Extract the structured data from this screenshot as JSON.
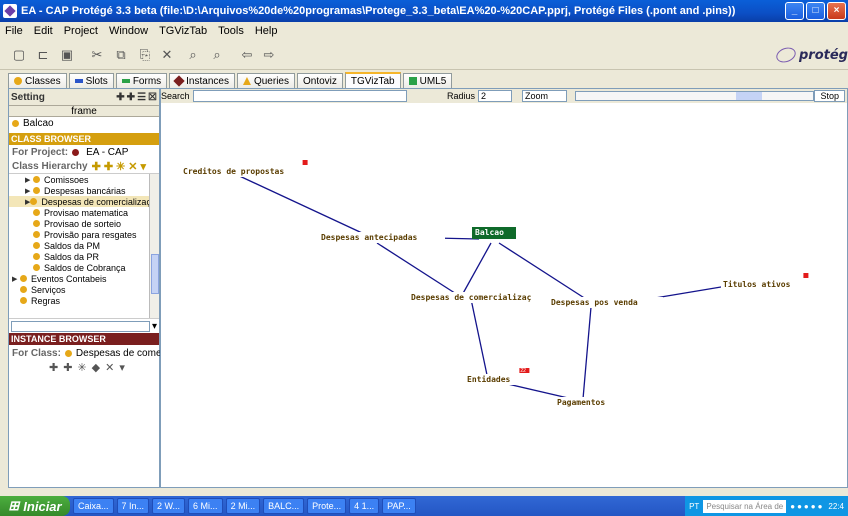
{
  "window": {
    "title": "EA - CAP  Protégé 3.3 beta    (file:\\D:\\Arquivos%20de%20programas\\Protege_3.3_beta\\EA%20-%20CAP.pprj, Protégé Files (.pont and .pins))"
  },
  "menu": [
    "File",
    "Edit",
    "Project",
    "Window",
    "TGVizTab",
    "Tools",
    "Help"
  ],
  "brand": "protég",
  "tabs": [
    {
      "label": "Classes",
      "color": "#e6a819"
    },
    {
      "label": "Slots",
      "color": "#2b55c9"
    },
    {
      "label": "Forms",
      "color": "#2aa148"
    },
    {
      "label": "Instances",
      "color": "#7a1f1f"
    },
    {
      "label": "Queries",
      "color": "#e6a819"
    },
    {
      "label": "Ontoviz",
      "color": ""
    },
    {
      "label": "TGVizTab",
      "color": ""
    },
    {
      "label": "UML5",
      "color": "#2aa148"
    }
  ],
  "left": {
    "setting_label": "Setting",
    "frame_header": "frame",
    "frame_value": "Balcao",
    "class_browser_title": "CLASS BROWSER",
    "for_project_label": "For Project:",
    "for_project_value": "EA - CAP",
    "class_hierarchy_label": "Class Hierarchy",
    "tree": [
      {
        "label": "Comissoes",
        "arrow": true,
        "indent": 1,
        "selected": false
      },
      {
        "label": "Despesas bancárias",
        "arrow": true,
        "indent": 1,
        "selected": false
      },
      {
        "label": "Despesas de comercialização",
        "arrow": true,
        "indent": 1,
        "selected": true
      },
      {
        "label": "Provisao matematica",
        "arrow": false,
        "indent": 1,
        "selected": false
      },
      {
        "label": "Provisao de sorteio",
        "arrow": false,
        "indent": 1,
        "selected": false
      },
      {
        "label": "Provisão para resgates",
        "arrow": false,
        "indent": 1,
        "selected": false
      },
      {
        "label": "Saldos da PM",
        "arrow": false,
        "indent": 1,
        "selected": false
      },
      {
        "label": "Saldos da PR",
        "arrow": false,
        "indent": 1,
        "selected": false
      },
      {
        "label": "Saldos de Cobrança",
        "arrow": false,
        "indent": 1,
        "selected": false
      },
      {
        "label": "Eventos Contabeis",
        "arrow": true,
        "indent": 0,
        "selected": false
      },
      {
        "label": "Serviços",
        "arrow": false,
        "indent": 0,
        "selected": false
      },
      {
        "label": "Regras",
        "arrow": false,
        "indent": 0,
        "selected": false
      }
    ],
    "instance_browser_title": "INSTANCE BROWSER",
    "for_class_label": "For Class:",
    "for_class_value": "Despesas de comercialização"
  },
  "graph_toolbar": {
    "search_label": "Search",
    "radius_label": "Radius",
    "radius_value": "2",
    "zoom_label": "Zoom",
    "stop_label": "Stop"
  },
  "graph": {
    "nodes": [
      {
        "id": "creditos",
        "label": "Creditos de propostas",
        "badge": ""
      },
      {
        "id": "antecipadas",
        "label": "Despesas antecipadas",
        "badge": ""
      },
      {
        "id": "balcao",
        "label": "Balcao",
        "badge": ""
      },
      {
        "id": "comercializ",
        "label": "Despesas de comercializaç",
        "badge": ""
      },
      {
        "id": "posvenda",
        "label": "Despesas pos venda",
        "badge": ""
      },
      {
        "id": "titulos",
        "label": "Titulos ativos",
        "badge": ""
      },
      {
        "id": "entidades",
        "label": "Entidades",
        "badge": "22"
      },
      {
        "id": "pagamentos",
        "label": "Pagamentos",
        "badge": ""
      }
    ]
  },
  "taskbar": {
    "start_label": "Iniciar",
    "items": [
      "Caixa...",
      "7 In...",
      "2 W...",
      "6 Mi...",
      "2 Mi...",
      "BALC...",
      "Prote...",
      "4 1...",
      "PAP..."
    ],
    "tray_lang": "PT",
    "tray_search": "Pesquisar na Área de",
    "clock": "22:4"
  }
}
